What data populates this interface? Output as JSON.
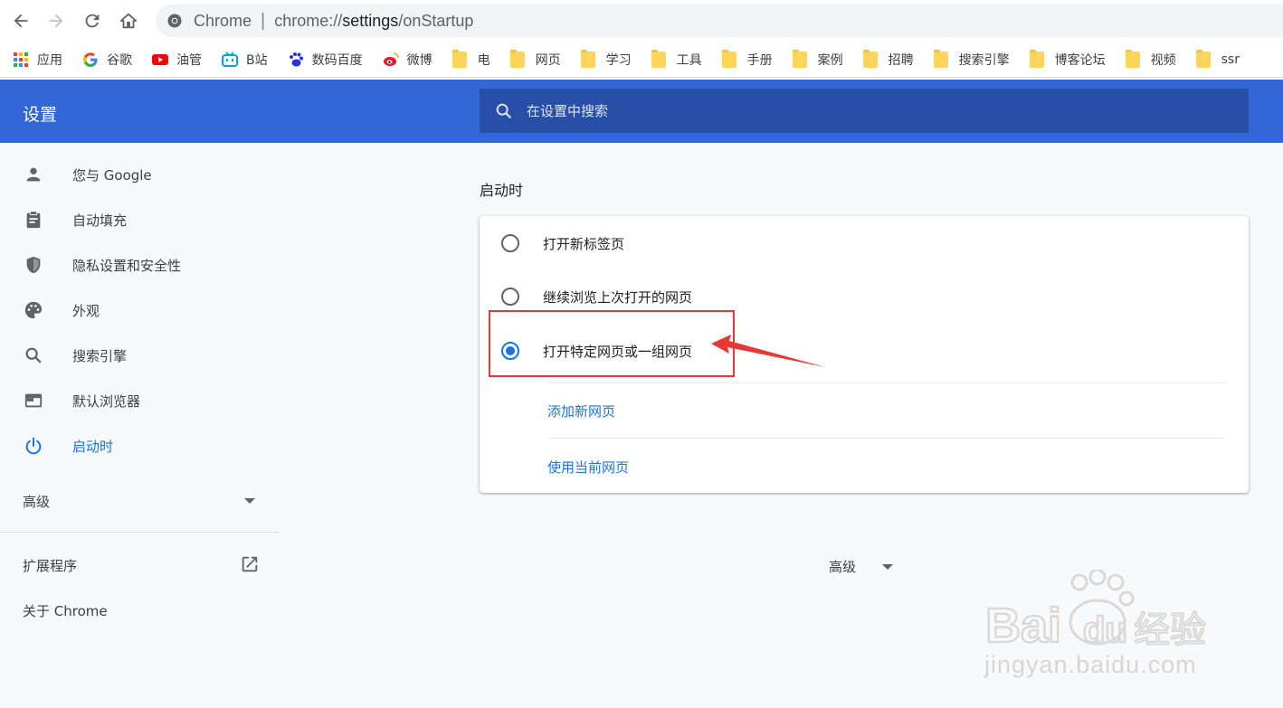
{
  "address_bar": {
    "site_label": "Chrome",
    "separator": "|",
    "url_prefix": "chrome://",
    "url_host": "settings",
    "url_path": "/onStartup"
  },
  "bookmarks": [
    {
      "label": "应用",
      "icon": "apps-grid-icon"
    },
    {
      "label": "谷歌",
      "icon": "google-icon"
    },
    {
      "label": "油管",
      "icon": "youtube-icon"
    },
    {
      "label": "B站",
      "icon": "bilibili-icon"
    },
    {
      "label": "数码百度",
      "icon": "baidu-paw-icon"
    },
    {
      "label": "微博",
      "icon": "weibo-icon"
    },
    {
      "label": "电",
      "icon": "folder-icon"
    },
    {
      "label": "网页",
      "icon": "folder-icon"
    },
    {
      "label": "学习",
      "icon": "folder-icon"
    },
    {
      "label": "工具",
      "icon": "folder-icon"
    },
    {
      "label": "手册",
      "icon": "folder-icon"
    },
    {
      "label": "案例",
      "icon": "folder-icon"
    },
    {
      "label": "招聘",
      "icon": "folder-icon"
    },
    {
      "label": "搜索引擎",
      "icon": "folder-icon"
    },
    {
      "label": "博客论坛",
      "icon": "folder-icon"
    },
    {
      "label": "视频",
      "icon": "folder-icon"
    },
    {
      "label": "ssr",
      "icon": "folder-icon"
    }
  ],
  "toolbar": {
    "title": "设置",
    "search_placeholder": "在设置中搜索"
  },
  "sidebar": {
    "items": [
      {
        "label": "您与 Google",
        "icon": "person-icon"
      },
      {
        "label": "自动填充",
        "icon": "clipboard-icon"
      },
      {
        "label": "隐私设置和安全性",
        "icon": "shield-icon"
      },
      {
        "label": "外观",
        "icon": "palette-icon"
      },
      {
        "label": "搜索引擎",
        "icon": "search-icon"
      },
      {
        "label": "默认浏览器",
        "icon": "browser-window-icon"
      },
      {
        "label": "启动时",
        "icon": "power-icon",
        "active": true
      }
    ],
    "advanced_label": "高级",
    "extensions_label": "扩展程序",
    "about_label": "关于 Chrome"
  },
  "main": {
    "section_title": "启动时",
    "options": [
      {
        "label": "打开新标签页",
        "checked": false
      },
      {
        "label": "继续浏览上次打开的网页",
        "checked": false
      },
      {
        "label": "打开特定网页或一组网页",
        "checked": true
      }
    ],
    "add_page_link": "添加新网页",
    "use_current_link": "使用当前网页",
    "advanced_label": "高级"
  },
  "watermark": {
    "text": "jingyan.baidu.com",
    "logo_text": "Baidu经验"
  },
  "colors": {
    "toolbar_blue": "#3367d6",
    "search_blue": "#284fa8",
    "accent_blue": "#1a73e8",
    "highlight_red": "#e53935"
  }
}
